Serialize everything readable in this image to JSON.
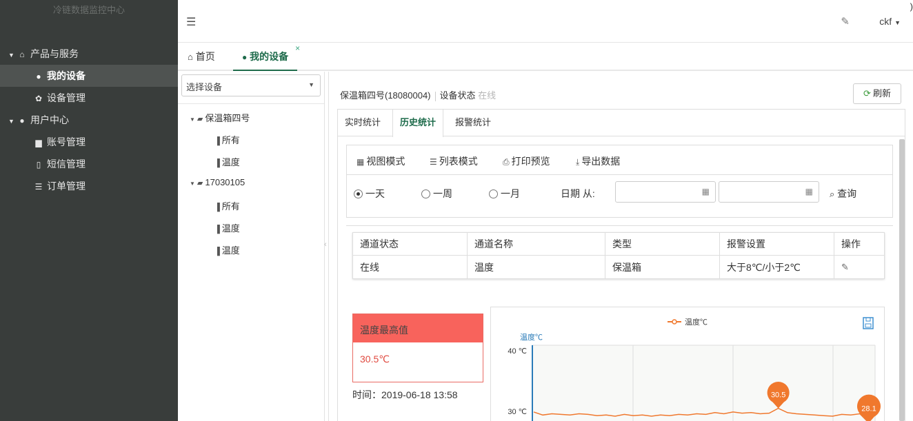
{
  "sidebar": {
    "brand": "冷链数据监控中心",
    "groups": [
      {
        "label": "产品与服务",
        "items": [
          {
            "label": "我的设备"
          },
          {
            "label": "设备管理"
          }
        ]
      },
      {
        "label": "用户中心",
        "items": [
          {
            "label": "账号管理"
          },
          {
            "label": "短信管理"
          },
          {
            "label": "订单管理"
          }
        ]
      }
    ]
  },
  "header": {
    "user": "ckf",
    "stray_char": ")"
  },
  "tabs": [
    {
      "label": "首页"
    },
    {
      "label": "我的设备"
    }
  ],
  "tree": {
    "select_placeholder": "选择设备",
    "devices": [
      {
        "name": "保温箱四号",
        "children": [
          "所有",
          "温度"
        ]
      },
      {
        "name": "17030105",
        "children": [
          "所有",
          "温度",
          "温度"
        ]
      }
    ]
  },
  "device": {
    "title": "保温箱四号(18080004)",
    "status_label": "设备状态",
    "status_value": "在线",
    "refresh_label": "刷新"
  },
  "subtabs": [
    {
      "label": "实时统计"
    },
    {
      "label": "历史统计"
    },
    {
      "label": "报警统计"
    }
  ],
  "toolbar": {
    "view_mode": "视图模式",
    "list_mode": "列表模式",
    "print_preview": "打印预览",
    "export_data": "导出数据"
  },
  "filter": {
    "ranges": [
      "一天",
      "一周",
      "一月"
    ],
    "selected_range": "一天",
    "date_from_label": "日期 从:",
    "query_label": "查询"
  },
  "channel_table": {
    "headers": [
      "通道状态",
      "通道名称",
      "类型",
      "报警设置",
      "操作"
    ],
    "rows": [
      [
        "在线",
        "温度",
        "保温箱",
        "大于8℃/小于2℃"
      ]
    ]
  },
  "max_panel": {
    "title": "温度最高值",
    "value": "30.5℃",
    "time": "时间：2019-06-18 13:58"
  },
  "colors": {
    "sidebar_bg": "#393d3b",
    "accent": "#1e6b4b",
    "line": "#f0782d",
    "max_header": "#f8635c"
  },
  "chart_data": {
    "type": "line",
    "legend": "温度℃",
    "ylabel": "温度℃",
    "yticks": [
      "40 ℃",
      "30 ℃"
    ],
    "ylim": [
      30,
      40
    ],
    "series": [
      {
        "name": "温度℃",
        "values": [
          29.9,
          29.4,
          29.6,
          29.5,
          29.4,
          29.6,
          29.5,
          29.3,
          29.4,
          29.2,
          29.5,
          29.3,
          29.4,
          29.2,
          29.4,
          29.3,
          29.5,
          29.4,
          29.6,
          29.5,
          29.8,
          29.6,
          29.9,
          29.7,
          29.8,
          29.6,
          29.7,
          30.5,
          29.8,
          29.6,
          29.5,
          29.4,
          29.3,
          29.2,
          29.5,
          29.4,
          29.6,
          28.1
        ]
      }
    ],
    "markers": [
      {
        "label": "30.5",
        "index": 27
      },
      {
        "label": "28.1",
        "index": 37
      }
    ]
  }
}
